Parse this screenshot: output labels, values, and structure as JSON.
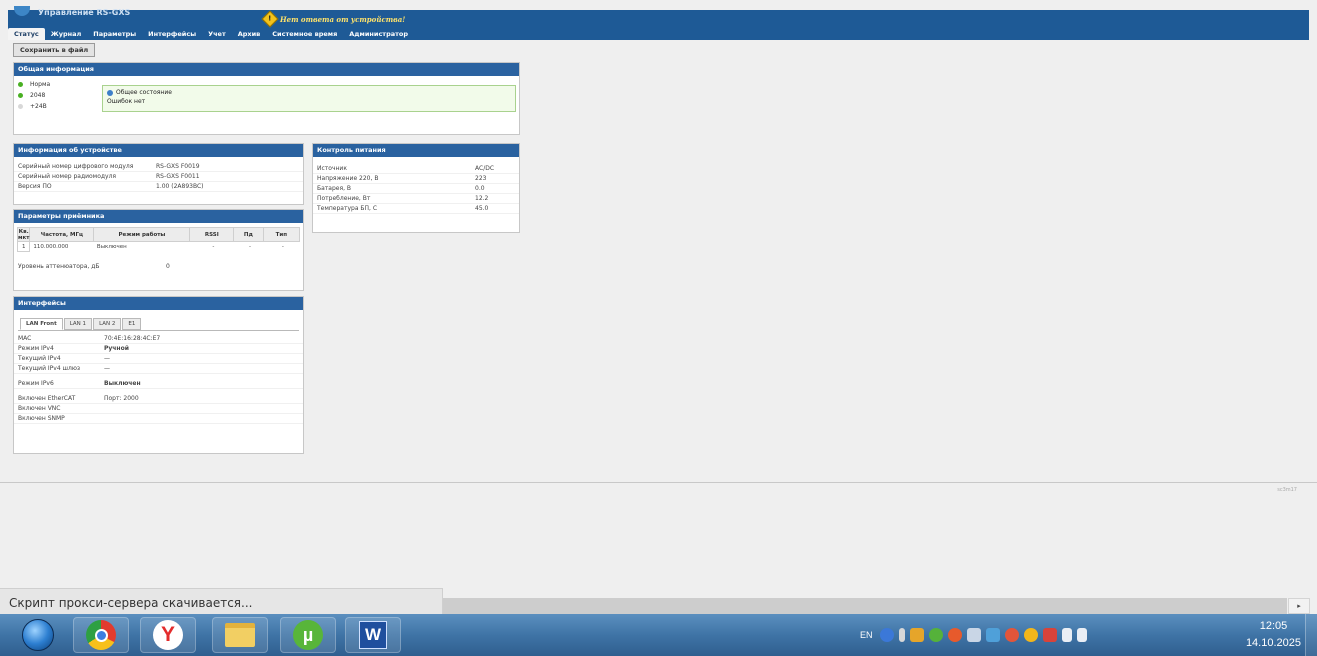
{
  "header": {
    "app_name": "Управление RS-GXS",
    "alert_text": "Нет ответа от устройства!",
    "tabs": [
      "Статус",
      "Журнал",
      "Параметры",
      "Интерфейсы",
      "Учет",
      "Архив",
      "Системное время",
      "Администратор"
    ],
    "active_tab": "Статус"
  },
  "toolbar": {
    "save_label": "Сохранить в файл"
  },
  "general": {
    "title": "Общая информация",
    "legend": [
      {
        "label": "Норма",
        "color": "green"
      },
      {
        "label": "2048",
        "color": "green"
      },
      {
        "label": "+24В",
        "color": "gray"
      }
    ],
    "state_title": "Общее состояние",
    "state_text": "Ошибок нет"
  },
  "device": {
    "title": "Информация об устройстве",
    "rows": [
      {
        "k": "Серийный номер цифрового модуля",
        "v": "RS-GXS F0019"
      },
      {
        "k": "Серийный номер радиомодуля",
        "v": "RS-GXS F0011"
      },
      {
        "k": "Версия ПО",
        "v": "1.00   (2A893BC)"
      }
    ]
  },
  "power": {
    "title": "Контроль питания",
    "rows": [
      {
        "k": "Источник",
        "v": "AC/DC"
      },
      {
        "k": "Напряжение 220, В",
        "v": "223"
      },
      {
        "k": "Батарея, В",
        "v": "0.0"
      },
      {
        "k": "Потребление, Вт",
        "v": "12.2"
      },
      {
        "k": "Температура БП, С",
        "v": "45.0"
      }
    ]
  },
  "receiver": {
    "title": "Параметры приёмника",
    "columns": [
      "Кв. мкт",
      "Частота, МГц",
      "Режим работы",
      "RSSI",
      "Пд",
      "Тип"
    ],
    "rows": [
      {
        "n": "1",
        "freq": "110.000.000",
        "mode": "Выключен",
        "rssi": "-",
        "pd": "-",
        "type": "-"
      }
    ],
    "atten_label": "Уровень аттенюатора, дБ",
    "atten_value": "0"
  },
  "interfaces": {
    "title": "Интерфейсы",
    "subtabs": [
      "LAN Front",
      "LAN 1",
      "LAN 2",
      "E1"
    ],
    "rows": [
      {
        "k": "MAC",
        "v": "70:4E:16:28:4C:E7",
        "bold": false
      },
      {
        "k": "Режим IPv4",
        "v": "Ручной",
        "bold": true
      },
      {
        "k": "Текущий IPv4",
        "v": "—",
        "bold": false
      },
      {
        "k": "Текущий IPv4 шлюз",
        "v": "—",
        "bold": false
      },
      {
        "k": "Режим IPv6",
        "v": "Выключен",
        "bold": true
      },
      {
        "k": "Включен EtherCAT",
        "v": "Порт: 2000",
        "bold": false
      },
      {
        "k": "Включен VNC",
        "v": "",
        "bold": false
      },
      {
        "k": "Включен SNMP",
        "v": "",
        "bold": false
      }
    ]
  },
  "version_label": "sc3m17",
  "statusbar": {
    "text": "Скрипт прокси-сервера скачивается..."
  },
  "taskbar": {
    "lang": "EN",
    "time": "12:05",
    "date": "14.10.2025"
  }
}
